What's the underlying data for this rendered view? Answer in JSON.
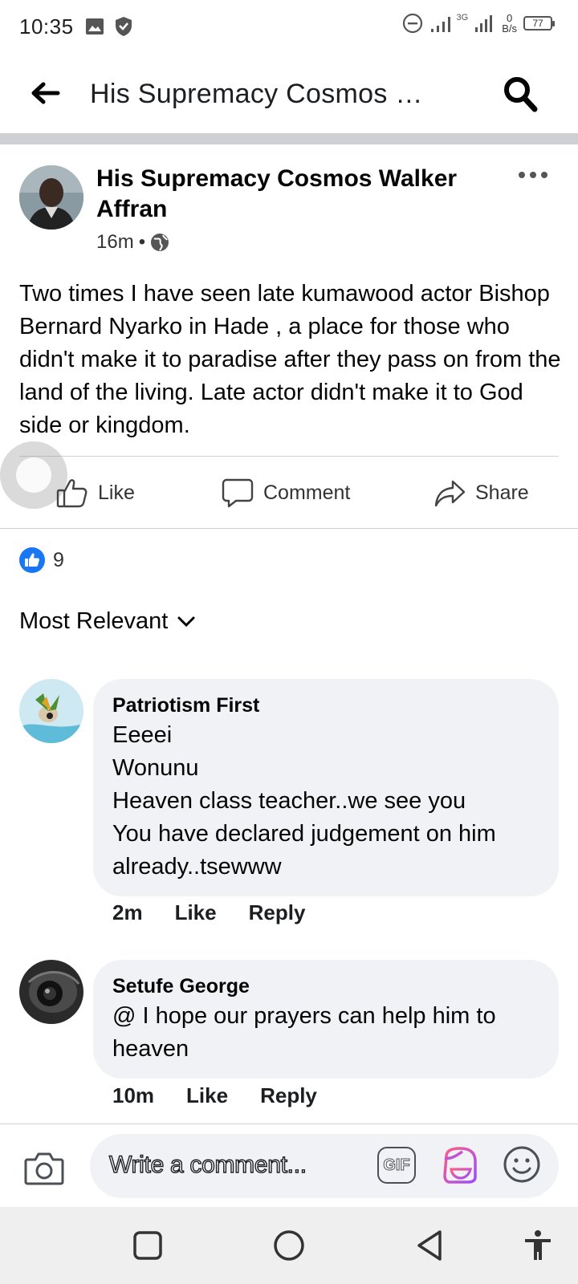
{
  "status_bar": {
    "time": "10:35",
    "network_label": "3G",
    "speed_value": "0",
    "speed_unit": "B/s",
    "battery": "77"
  },
  "header": {
    "title": "His  Supremacy   Cosmos Walker Affran"
  },
  "post": {
    "author": "His  Supremacy   Cosmos Walker Affran",
    "time": "16m",
    "separator": "•",
    "body": "Two times I have seen late kumawood  actor Bishop  Bernard Nyarko   in  Hade  , a place for those who didn't  make it to paradise after they pass on from the land  of the   living.   Late actor didn't make it to God side or kingdom.",
    "actions": {
      "like": "Like",
      "comment": "Comment",
      "share": "Share"
    },
    "reaction_count": "9"
  },
  "sort": {
    "label": "Most Relevant"
  },
  "comments": [
    {
      "author": "Patriotism First",
      "text": "Eeeei\nWonunu\nHeaven class teacher..we see you\nYou have declared judgement on him already..tsewww",
      "time": "2m",
      "like": "Like",
      "reply": "Reply"
    },
    {
      "author": "Setufe George",
      "text": "@ I hope our prayers can help him to heaven",
      "time": "10m",
      "like": "Like",
      "reply": "Reply"
    }
  ],
  "composer": {
    "placeholder": "Write a comment...",
    "gif_label": "GIF"
  },
  "colors": {
    "accent": "#1877f2",
    "bubble": "#f0f2f5",
    "divider": "#ced0d4"
  }
}
